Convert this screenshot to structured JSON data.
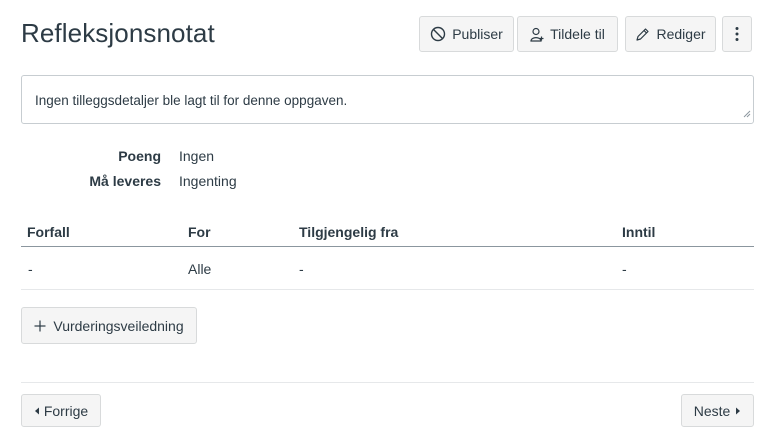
{
  "page": {
    "title": "Refleksjonsnotat"
  },
  "toolbar": {
    "publish_label": "Publiser",
    "assign_label": "Tildele til",
    "edit_label": "Rediger"
  },
  "description": {
    "text": "Ingen tilleggsdetaljer ble lagt til for denne oppgaven."
  },
  "details": [
    {
      "label": "Poeng",
      "value": "Ingen"
    },
    {
      "label": "Må leveres",
      "value": "Ingenting"
    }
  ],
  "table": {
    "headers": [
      "Forfall",
      "For",
      "Tilgjengelig fra",
      "Inntil"
    ],
    "rows": [
      [
        "-",
        "Alle",
        "-",
        "-"
      ]
    ]
  },
  "rubric": {
    "label": "Vurderingsveiledning"
  },
  "nav": {
    "prev_label": "Forrige",
    "next_label": "Neste"
  },
  "colors": {
    "text": "#2d3b45",
    "button_bg": "#f5f5f5",
    "button_border": "#d8dadb",
    "divider": "#c7cdd1"
  }
}
